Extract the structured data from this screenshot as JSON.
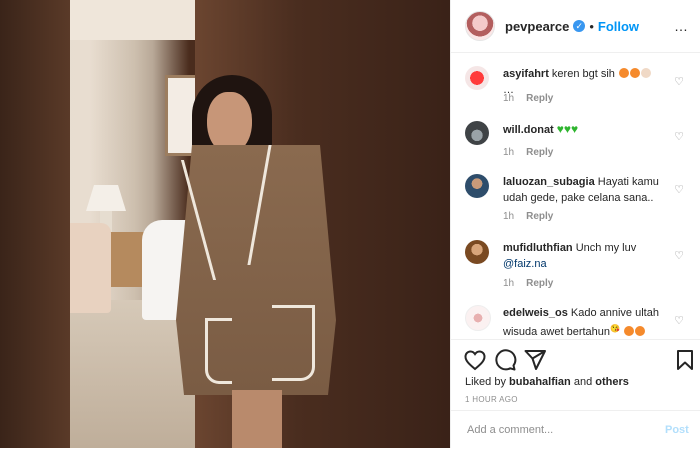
{
  "post": {
    "username": "pevpearce",
    "follow_label": "Follow",
    "dot": "•",
    "more": "…"
  },
  "comments": [
    {
      "user": "asyifahrt",
      "text": "keren bgt sih",
      "suffix": "…",
      "time": "1h",
      "reply": "Reply",
      "avatar_color": "#d9262b"
    },
    {
      "user": "will.donat",
      "text": "",
      "time": "1h",
      "reply": "Reply",
      "avatar_color": "#4b4b52"
    },
    {
      "user": "laluozan_subagia",
      "text": "Hayati kamu udah gede, pake celana sana..",
      "time": "1h",
      "reply": "Reply",
      "avatar_color": "#3d5a7a"
    },
    {
      "user": "mufidluthfian",
      "text": "Unch my luv",
      "mention": "@faiz.na",
      "time": "1h",
      "reply": "Reply",
      "avatar_color": "#b07a3c"
    },
    {
      "user": "edelweis_os",
      "text": "Kado annive ultah wisuda awet bertahun",
      "suffix": "😘",
      "time": "",
      "reply": "",
      "avatar_color": "#f3e6e6"
    }
  ],
  "actions": {
    "liked_by_prefix": "Liked by",
    "liked_by_user": "bubahalfian",
    "and": "and",
    "others": "others",
    "timestamp": "1 HOUR AGO"
  },
  "composer": {
    "placeholder": "Add a comment...",
    "post_label": "Post"
  },
  "colors": {
    "link": "#0095f6",
    "muted": "#8e8e8e",
    "border": "#efefef"
  }
}
